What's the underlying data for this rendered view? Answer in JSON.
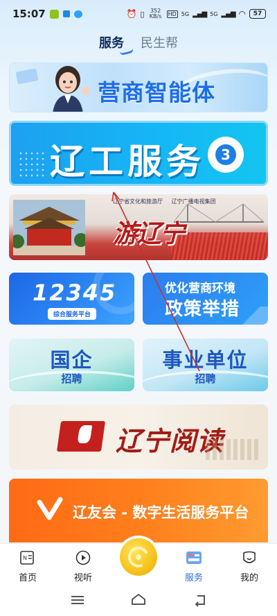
{
  "status": {
    "time": "15:07",
    "net_speed": "352 KB/s",
    "sig1": "5G",
    "sig2": "5G",
    "battery": "57"
  },
  "tabs": [
    {
      "label": "服务",
      "active": true
    },
    {
      "label": "民生帮",
      "active": false
    }
  ],
  "cards": {
    "assistant": {
      "title": "营商智能体"
    },
    "ligong": {
      "title": "辽工服务",
      "badge": "3"
    },
    "travel": {
      "title": "游辽宁",
      "org1": "辽宁省文化和旅游厅",
      "org2": "辽宁广播电视集团"
    },
    "hotline": {
      "number": "12345",
      "sub": "综合服务平台"
    },
    "policy": {
      "line1": "优化营商环境",
      "line2": "政策举措"
    },
    "soe": {
      "line1": "国企",
      "line2": "招聘"
    },
    "public_inst": {
      "line1": "事业单位",
      "line2": "招聘"
    },
    "reading": {
      "title": "辽宁阅读"
    },
    "liaoyou": {
      "title": "辽友会 - 数字生活服务平台"
    }
  },
  "bottom_nav": [
    {
      "label": "首页",
      "icon": "news-icon"
    },
    {
      "label": "视听",
      "icon": "play-icon"
    },
    {
      "label": "",
      "icon": "center-logo-icon"
    },
    {
      "label": "服务",
      "icon": "help-icon",
      "active": true
    },
    {
      "label": "我的",
      "icon": "profile-icon"
    }
  ],
  "colors": {
    "accent": "#2a6ed6",
    "ligong_bg": "#1da0f0",
    "liaoyou_bg": "#ff7e1c"
  }
}
